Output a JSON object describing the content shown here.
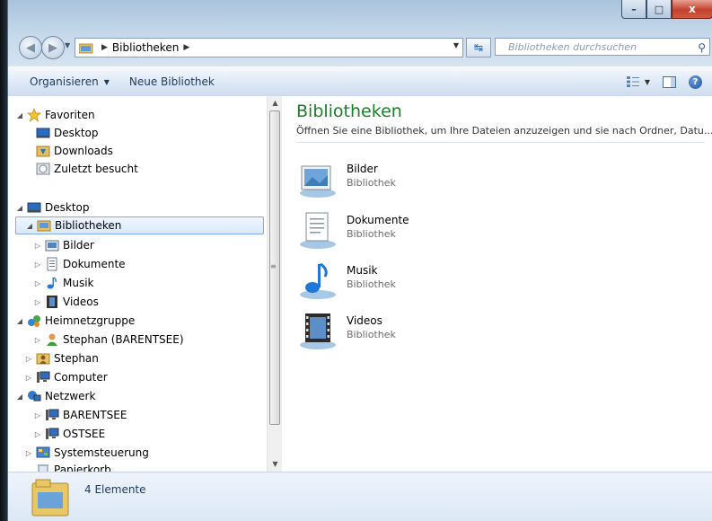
{
  "window": {
    "caption": {
      "minimize": "–",
      "maximize": "□",
      "close": "x"
    }
  },
  "address": {
    "crumb": "Bibliotheken",
    "search_placeholder": "Bibliotheken durchsuchen"
  },
  "toolbar": {
    "organize": "Organisieren",
    "new_library": "Neue Bibliothek"
  },
  "nav": {
    "items": [
      {
        "label": "Favoriten",
        "icon": "star-icon"
      },
      {
        "label": "Desktop",
        "icon": "desktop-icon"
      },
      {
        "label": "Downloads",
        "icon": "downloads-icon"
      },
      {
        "label": "Zuletzt besucht",
        "icon": "recent-places-icon"
      },
      {
        "label": "Desktop",
        "icon": "desktop-icon"
      },
      {
        "label": "Bibliotheken",
        "icon": "libraries-icon"
      },
      {
        "label": "Bilder",
        "icon": "pictures-icon"
      },
      {
        "label": "Dokumente",
        "icon": "documents-icon"
      },
      {
        "label": "Musik",
        "icon": "music-icon"
      },
      {
        "label": "Videos",
        "icon": "videos-icon"
      },
      {
        "label": "Heimnetzgruppe",
        "icon": "homegroup-icon"
      },
      {
        "label": "Stephan (BARENTSEE)",
        "icon": "user-icon"
      },
      {
        "label": "Stephan",
        "icon": "user-folder-icon"
      },
      {
        "label": "Computer",
        "icon": "computer-icon"
      },
      {
        "label": "Netzwerk",
        "icon": "network-icon"
      },
      {
        "label": "BARENTSEE",
        "icon": "network-computer-icon"
      },
      {
        "label": "OSTSEE",
        "icon": "network-computer-icon"
      },
      {
        "label": "Systemsteuerung",
        "icon": "control-panel-icon"
      },
      {
        "label": "Papierkorb",
        "icon": "recycle-bin-icon"
      }
    ]
  },
  "content": {
    "title": "Bibliotheken",
    "subtitle": "Öffnen Sie eine Bibliothek, um Ihre Dateien anzuzeigen und sie nach Ordner, Datu...",
    "libraries": [
      {
        "name": "Bilder",
        "type": "Bibliothek",
        "icon": "pictures-library-icon"
      },
      {
        "name": "Dokumente",
        "type": "Bibliothek",
        "icon": "documents-library-icon"
      },
      {
        "name": "Musik",
        "type": "Bibliothek",
        "icon": "music-library-icon"
      },
      {
        "name": "Videos",
        "type": "Bibliothek",
        "icon": "videos-library-icon"
      }
    ]
  },
  "details": {
    "count": "4 Elemente"
  },
  "colors": {
    "title_green": "#1e7c2a",
    "selection": "#d9e9fb",
    "toolbar_text": "#1e395b"
  }
}
